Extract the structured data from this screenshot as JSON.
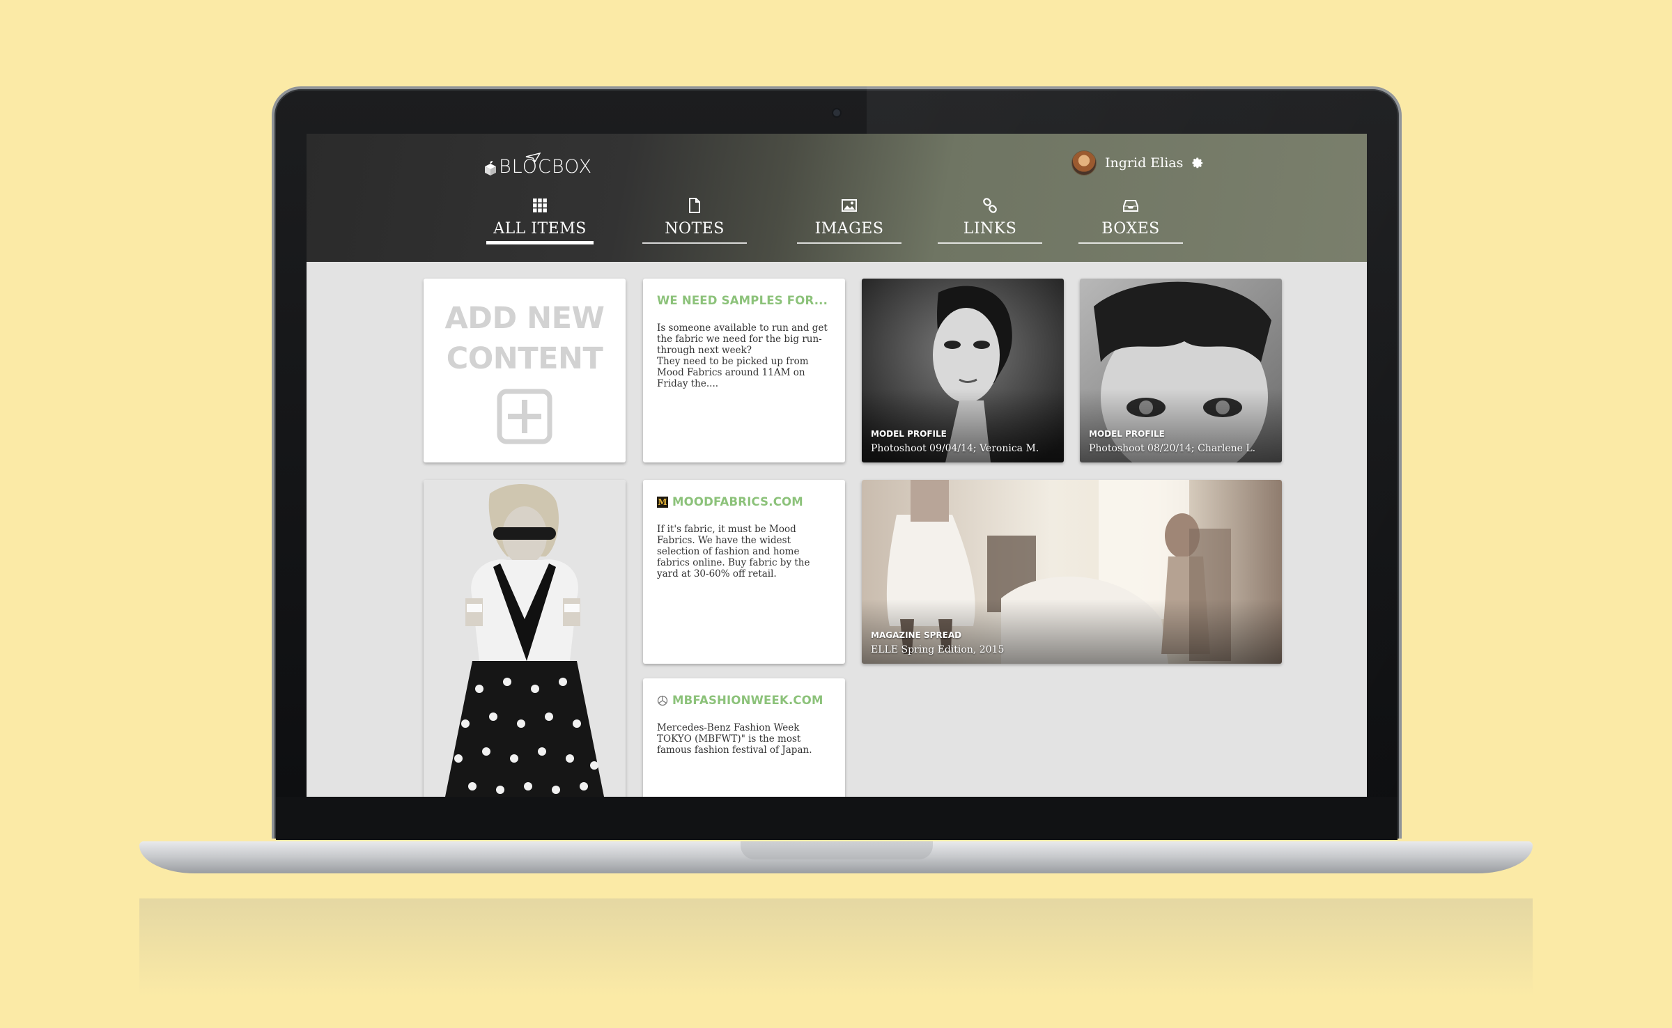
{
  "brand": {
    "name": "BLOCBOX"
  },
  "user": {
    "name": "Ingrid Elias"
  },
  "tabs": [
    {
      "label": "ALL ITEMS",
      "icon": "grid-icon",
      "active": true
    },
    {
      "label": "NOTES",
      "icon": "document-icon",
      "active": false
    },
    {
      "label": "IMAGES",
      "icon": "image-icon",
      "active": false
    },
    {
      "label": "LINKS",
      "icon": "link-icon",
      "active": false
    },
    {
      "label": "BOXES",
      "icon": "inbox-icon",
      "active": false
    }
  ],
  "add_card": {
    "title": "ADD NEW\nCONTENT"
  },
  "notes": [
    {
      "title": "WE NEED SAMPLES FOR...",
      "body": "Is someone available to run and get the fabric we need for the big run-through next week?\nThey need to be picked up from Mood Fabrics around 11AM on Friday the...."
    },
    {
      "title": "MOODFABRICS.COM",
      "icon": "mood-fabrics-icon",
      "icon_glyph": "M",
      "body": "If it's fabric, it must be Mood Fabrics. We have the widest selection of fashion and home fabrics online. Buy fabric by the yard at 30-60% off retail."
    },
    {
      "title": "MBFASHIONWEEK.COM",
      "icon": "mercedes-benz-icon",
      "body": "Mercedes-Benz Fashion Week TOKYO (MBFWT)\" is the most famous fashion festival of Japan."
    }
  ],
  "photos": [
    {
      "kicker": "MODEL PROFILE",
      "caption": "Photoshoot 09/04/14; Veronica M."
    },
    {
      "kicker": "MODEL PROFILE",
      "caption": "Photoshoot 08/20/14; Charlene L."
    },
    {
      "kicker": "MAGAZINE SPREAD",
      "caption": "ELLE Spring Edition, 2015"
    }
  ],
  "colors": {
    "background": "#fbeaa6",
    "header_dark": "#2b2b2b",
    "header_olive": "#7a7f6c",
    "note_title": "#8cc27a",
    "canvas": "#e3e3e3"
  }
}
